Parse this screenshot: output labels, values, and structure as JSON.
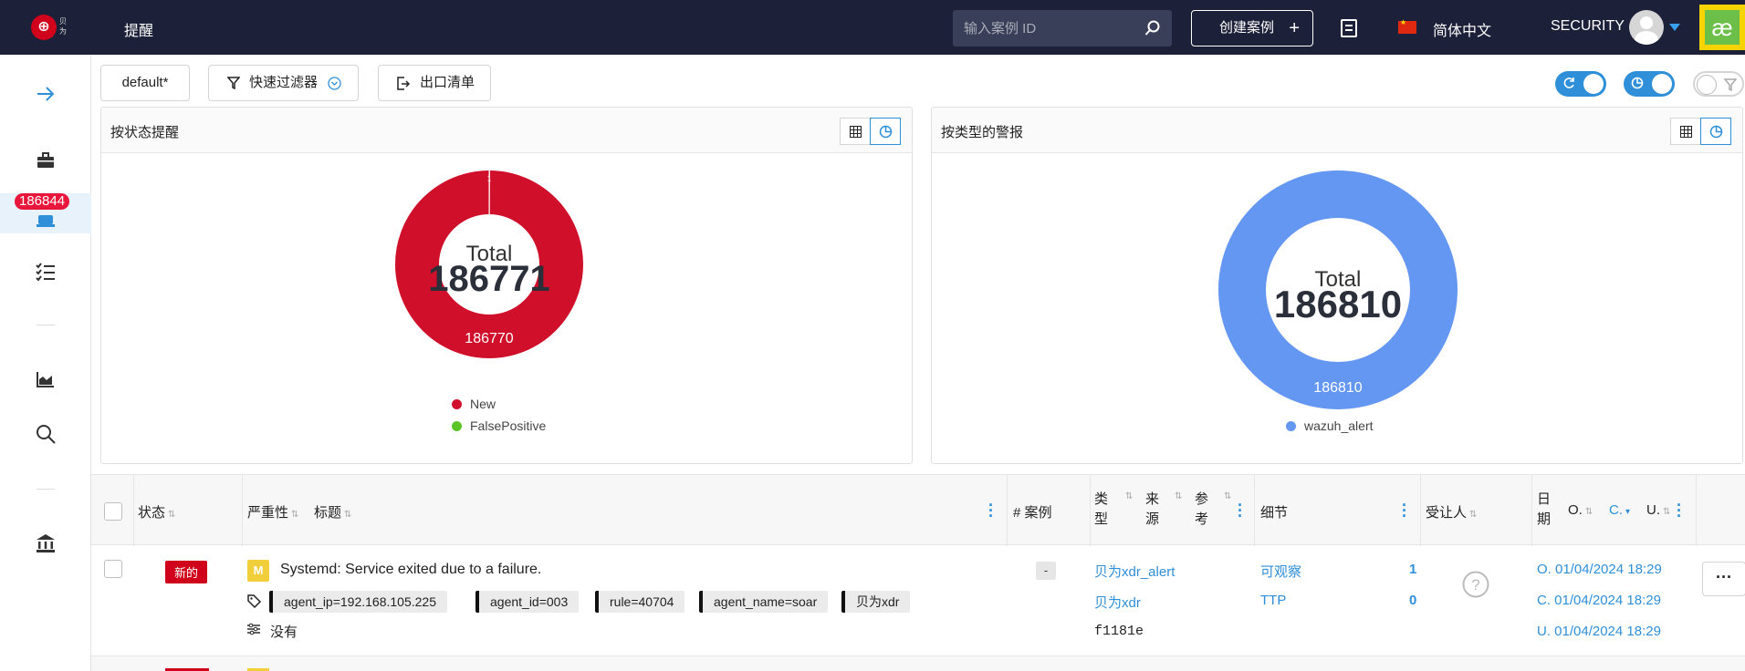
{
  "header": {
    "logo_text": "贝为",
    "title": "提醒",
    "search_placeholder": "输入案例 ID",
    "create_label": "创建案例",
    "language": "简体中文",
    "user": "SECURITY"
  },
  "sidebar": {
    "alert_count": "186844"
  },
  "filters": {
    "preset": "default*",
    "quick_filter": "快速过滤器",
    "export": "出口清单"
  },
  "panels": {
    "status": {
      "title": "按状态提醒",
      "total_label": "Total",
      "total": "186771",
      "slice_label": "186770",
      "small_label": "1",
      "legend": [
        {
          "name": "New",
          "color": "#d0102a"
        },
        {
          "name": "FalsePositive",
          "color": "#5cc429"
        }
      ]
    },
    "type": {
      "title": "按类型的警报",
      "total_label": "Total",
      "total": "186810",
      "slice_label": "186810",
      "legend": [
        {
          "name": "wazuh_alert",
          "color": "#6497f2"
        }
      ]
    }
  },
  "chart_data": [
    {
      "type": "pie",
      "title": "按状态提醒",
      "categories": [
        "New",
        "FalsePositive"
      ],
      "values": [
        186770,
        1
      ]
    },
    {
      "type": "pie",
      "title": "按类型的警报",
      "categories": [
        "wazuh_alert"
      ],
      "values": [
        186810
      ]
    }
  ],
  "table": {
    "headers": {
      "status": "状态",
      "severity": "严重性",
      "title": "标题",
      "cases": "# 案例",
      "type": "类型",
      "source": "来源",
      "ref": "参考",
      "details": "细节",
      "assignee": "受让人",
      "date": "日期",
      "o": "O.",
      "c": "C.",
      "u": "U."
    },
    "rows": [
      {
        "status": "新的",
        "severity": "M",
        "title": "Systemd: Service exited due to a failure.",
        "tags": [
          "agent_ip=192.168.105.225",
          "agent_id=003",
          "rule=40704",
          "agent_name=soar",
          "贝为xdr"
        ],
        "observables_label": "没有",
        "cases": "-",
        "type": "贝为xdr_alert",
        "source": "贝为xdr",
        "ref": "f1181e",
        "details_observables": "可观察",
        "details_observables_count": "1",
        "details_ttp": "TTP",
        "details_ttp_count": "0",
        "date_o": "O. 01/04/2024 18:29",
        "date_c": "C. 01/04/2024 18:29",
        "date_u": "U. 01/04/2024 18:29",
        "actions": "···"
      }
    ]
  }
}
